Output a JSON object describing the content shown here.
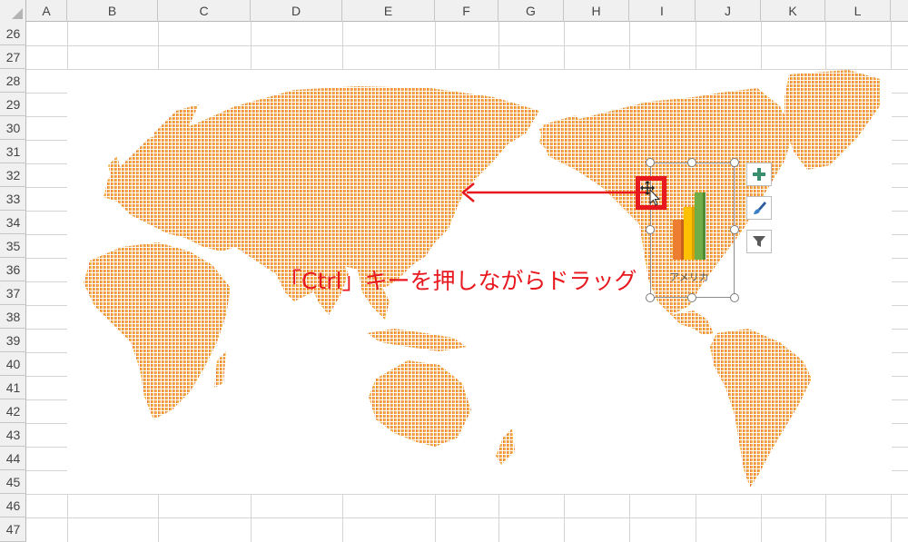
{
  "columns": [
    "A",
    "B",
    "C",
    "D",
    "E",
    "F",
    "G",
    "H",
    "I",
    "J",
    "K",
    "L"
  ],
  "rows": [
    "26",
    "27",
    "28",
    "29",
    "30",
    "31",
    "32",
    "33",
    "34",
    "35",
    "36",
    "37",
    "38",
    "39",
    "40",
    "41",
    "42",
    "43",
    "44",
    "45",
    "46",
    "47"
  ],
  "chart": {
    "label": "アメリカ",
    "bar_colors": [
      "#ed7d31",
      "#ffc000",
      "#70ad47"
    ],
    "tools": [
      "plus-icon",
      "brush-icon",
      "filter-icon"
    ]
  },
  "annotation": {
    "text": "「Ctrl」キーを押しながらドラッグ",
    "color": "#e8181f"
  },
  "map": {
    "gradient": [
      "#e8504a",
      "#f4a13c",
      "#fbd34a"
    ]
  }
}
